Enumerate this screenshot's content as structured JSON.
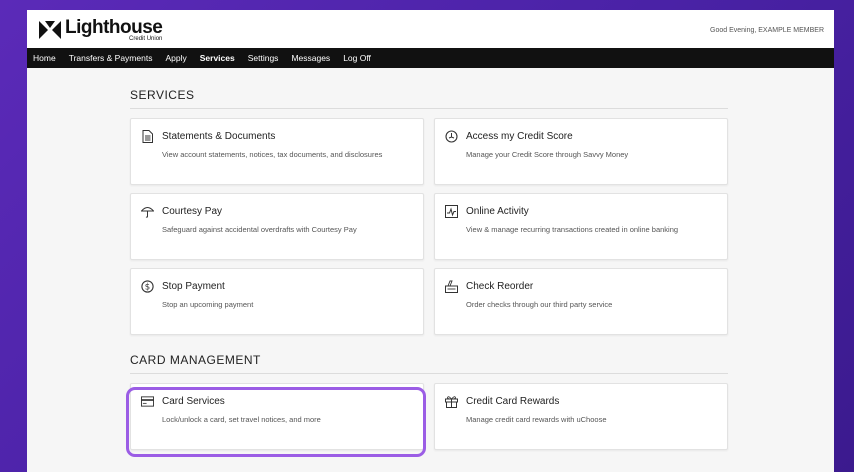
{
  "header": {
    "logo_name": "Lighthouse",
    "logo_sub": "Credit Union",
    "greeting": "Good Evening, EXAMPLE MEMBER"
  },
  "nav": {
    "items": [
      {
        "label": "Home"
      },
      {
        "label": "Transfers & Payments"
      },
      {
        "label": "Apply"
      },
      {
        "label": "Services",
        "active": true
      },
      {
        "label": "Settings"
      },
      {
        "label": "Messages"
      },
      {
        "label": "Log Off"
      }
    ]
  },
  "services": {
    "title": "SERVICES",
    "cards": [
      {
        "icon": "document-icon",
        "title": "Statements & Documents",
        "desc": "View account statements, notices, tax documents, and disclosures"
      },
      {
        "icon": "credit-score-icon",
        "title": "Access my Credit Score",
        "desc": "Manage your Credit Score through Savvy Money"
      },
      {
        "icon": "umbrella-icon",
        "title": "Courtesy Pay",
        "desc": "Safeguard against accidental overdrafts with Courtesy Pay"
      },
      {
        "icon": "activity-icon",
        "title": "Online Activity",
        "desc": "View & manage recurring transactions created in online banking"
      },
      {
        "icon": "dollar-icon",
        "title": "Stop Payment",
        "desc": "Stop an upcoming payment"
      },
      {
        "icon": "checkbook-icon",
        "title": "Check Reorder",
        "desc": "Order checks through our third party service"
      }
    ]
  },
  "card_management": {
    "title": "CARD MANAGEMENT",
    "cards": [
      {
        "icon": "credit-card-icon",
        "title": "Card Services",
        "desc": "Lock/unlock a card, set travel notices, and more"
      },
      {
        "icon": "gift-icon",
        "title": "Credit Card Rewards",
        "desc": "Manage credit card rewards with uChoose"
      }
    ]
  },
  "colors": {
    "background": "#4a22a6",
    "navbar": "#111111",
    "highlight": "#9b5de5"
  }
}
